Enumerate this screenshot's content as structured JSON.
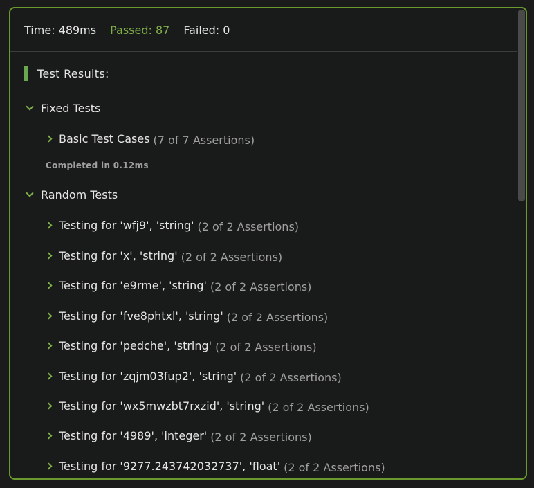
{
  "summary": {
    "time": "Time: 489ms",
    "passed": "Passed: 87",
    "failed": "Failed: 0"
  },
  "results_title": "Test Results:",
  "colors": {
    "accent": "#6a9a2e",
    "passed": "#7fb04a",
    "muted": "#a0a0a0"
  },
  "fixed_tests": {
    "label": "Fixed Tests",
    "items": [
      {
        "label": "Basic Test Cases",
        "assertions": "(7 of 7 Assertions)"
      }
    ],
    "completed": "Completed in 0.12ms"
  },
  "random_tests": {
    "label": "Random Tests",
    "items": [
      {
        "label": "Testing for 'wfj9', 'string'",
        "assertions": "(2 of 2 Assertions)"
      },
      {
        "label": "Testing for 'x', 'string'",
        "assertions": "(2 of 2 Assertions)"
      },
      {
        "label": "Testing for 'e9rme', 'string'",
        "assertions": "(2 of 2 Assertions)"
      },
      {
        "label": "Testing for 'fve8phtxl', 'string'",
        "assertions": "(2 of 2 Assertions)"
      },
      {
        "label": "Testing for 'pedche', 'string'",
        "assertions": "(2 of 2 Assertions)"
      },
      {
        "label": "Testing for 'zqjm03fup2', 'string'",
        "assertions": "(2 of 2 Assertions)"
      },
      {
        "label": "Testing for 'wx5mwzbt7rxzid', 'string'",
        "assertions": "(2 of 2 Assertions)"
      },
      {
        "label": "Testing for '4989', 'integer'",
        "assertions": "(2 of 2 Assertions)"
      },
      {
        "label": "Testing for '9277.243742032737', 'float'",
        "assertions": "(2 of 2 Assertions)"
      }
    ]
  }
}
